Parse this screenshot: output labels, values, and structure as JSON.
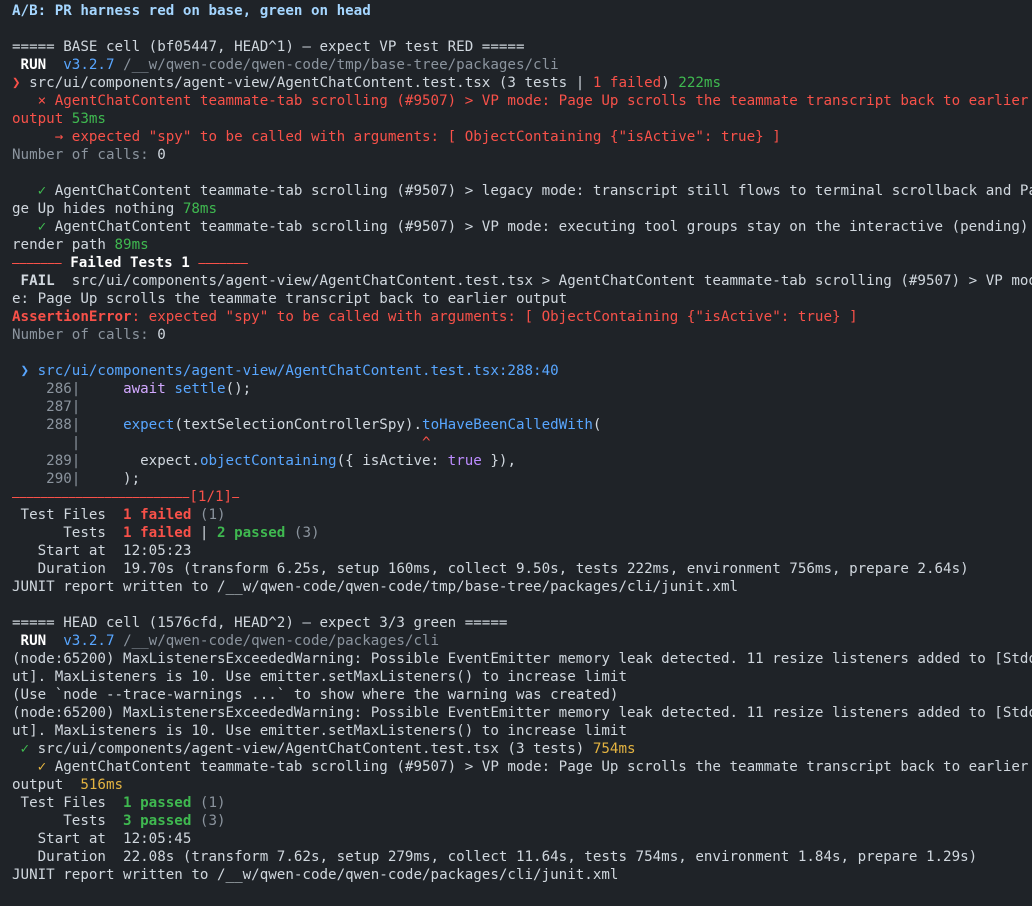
{
  "title": "A/B: PR harness red on base, green on head",
  "base": {
    "header": "===== BASE cell (bf05447, HEAD^1) — expect VP test RED =====",
    "run_label": "RUN",
    "version": "v3.2.7",
    "path": "/__w/qwen-code/qwen-code/tmp/base-tree/packages/cli",
    "suite": {
      "prefix": "❯ ",
      "file": "src/ui/components/agent-view/AgentChatContent.test.tsx",
      "counts_a": " (3 tests | ",
      "failed": "1 failed",
      "counts_b": ") ",
      "time": "222ms"
    },
    "fail_case_1": "   × AgentChatContent teammate-tab scrolling (#9507) > VP mode: Page Up scrolls the teammate transcript back to earlier",
    "fail_case_2a": "output ",
    "fail_case_2b": "53ms",
    "arrow_msg": "     → expected \"spy\" to be called with arguments: [ ObjectContaining {\"isActive\": true} ]",
    "calls_label": "Number of calls: ",
    "calls_value": "0",
    "pass_1a": "   ✓ ",
    "pass_1b": "AgentChatContent teammate-tab scrolling (#9507) > legacy mode: transcript still flows to terminal scrollback and Pa",
    "pass_1c": "ge Up hides nothing ",
    "pass_1d": "78ms",
    "pass_2a": "   ✓ ",
    "pass_2b": "AgentChatContent teammate-tab scrolling (#9507) > VP mode: executing tool groups stay on the interactive (pending)",
    "pass_2c": "render path ",
    "pass_2d": "89ms",
    "failed_bar_left": "⎯⎯⎯⎯⎯⎯⎯",
    "failed_bar_title": " Failed Tests 1 ",
    "failed_bar_right": "⎯⎯⎯⎯⎯⎯⎯",
    "fail_tag": " FAIL ",
    "fail_line_1": " src/ui/components/agent-view/AgentChatContent.test.tsx > AgentChatContent teammate-tab scrolling (#9507) > VP mod",
    "fail_line_2": "e: Page Up scrolls the teammate transcript back to earlier output",
    "assert_label": "AssertionError",
    "assert_msg": ": expected \"spy\" to be called with arguments: [ ObjectContaining {\"isActive\": true} ]",
    "loc_prefix": " ❯ ",
    "loc": "src/ui/components/agent-view/AgentChatContent.test.tsx:288:40",
    "code": [
      {
        "no": "    286|",
        "text_a": "     ",
        "kw": "await",
        "text_b": " ",
        "fn": "settle",
        "text_c": "();"
      },
      {
        "no": "    287|",
        "text_a": "",
        "kw": "",
        "text_b": "",
        "fn": "",
        "text_c": ""
      },
      {
        "no": "    288|",
        "text_a": "     ",
        "kw": "",
        "text_b": "",
        "fn": "expect",
        "text_c": "(textSelectionControllerSpy)."
      },
      {
        "no": "       |",
        "caret_pad": "                                        ",
        "caret": "^"
      },
      {
        "no": "    289|",
        "text_a": "       expect.",
        "fn": "objectContaining",
        "text_c": "({ isActive: ",
        "bool": "true",
        "text_d": " }),"
      },
      {
        "no": "    290|",
        "text_a": "     );"
      }
    ],
    "code_method": "toHaveBeenCalledWith",
    "code_paren": "(",
    "pager_bar": "⎯⎯⎯⎯⎯⎯⎯⎯⎯⎯⎯⎯⎯⎯⎯⎯⎯⎯⎯⎯⎯⎯⎯⎯⎯",
    "pager": "[1/1]⎯",
    "summary": {
      "files_label": " Test Files  ",
      "files_failed": "1 failed",
      "files_total": " (1)",
      "tests_label": "      Tests  ",
      "tests_failed": "1 failed",
      "tests_sep": " | ",
      "tests_passed": "2 passed",
      "tests_total": " (3)",
      "start_label": "   Start at  ",
      "start_value": "12:05:23",
      "duration_label": "   Duration  ",
      "duration_value": "19.70s (transform 6.25s, setup 160ms, collect 9.50s, tests 222ms, environment 756ms, prepare 2.64s)"
    },
    "junit": "JUNIT report written to /__w/qwen-code/qwen-code/tmp/base-tree/packages/cli/junit.xml"
  },
  "head": {
    "header": "===== HEAD cell (1576cfd, HEAD^2) — expect 3/3 green =====",
    "run_label": "RUN",
    "version": "v3.2.7",
    "path": "/__w/qwen-code/qwen-code/packages/cli",
    "warn_1a": "(node:65200) MaxListenersExceededWarning: Possible EventEmitter memory leak detected. 11 resize listeners added to [Stdo",
    "warn_1b": "ut]. MaxListeners is 10. Use emitter.setMaxListeners() to increase limit",
    "warn_hint": "(Use `node --trace-warnings ...` to show where the warning was created)",
    "warn_2a": "(node:65200) MaxListenersExceededWarning: Possible EventEmitter memory leak detected. 11 resize listeners added to [Stdo",
    "warn_2b": "ut]. MaxListeners is 10. Use emitter.setMaxListeners() to increase limit",
    "suite": {
      "prefix": " ✓ ",
      "file": "src/ui/components/agent-view/AgentChatContent.test.tsx",
      "counts": " (3 tests) ",
      "time": "754ms"
    },
    "pass_a": "   ✓ ",
    "pass_b": "AgentChatContent teammate-tab scrolling (#9507) > VP mode: Page Up scrolls the teammate transcript back to earlier",
    "pass_c": "output  ",
    "pass_d": "516ms",
    "summary": {
      "files_label": " Test Files  ",
      "files_passed": "1 passed",
      "files_total": " (1)",
      "tests_label": "      Tests  ",
      "tests_passed": "3 passed",
      "tests_total": " (3)",
      "start_label": "   Start at  ",
      "start_value": "12:05:45",
      "duration_label": "   Duration  ",
      "duration_value": "22.08s (transform 7.62s, setup 279ms, collect 11.64s, tests 754ms, environment 1.84s, prepare 1.29s)"
    },
    "junit": "JUNIT report written to /__w/qwen-code/qwen-code/packages/cli/junit.xml"
  },
  "colors": {
    "background": "#1f2328",
    "red": "#f85149",
    "green": "#3fb950",
    "yellow": "#e3b341",
    "cyan": "#58a6ff"
  }
}
